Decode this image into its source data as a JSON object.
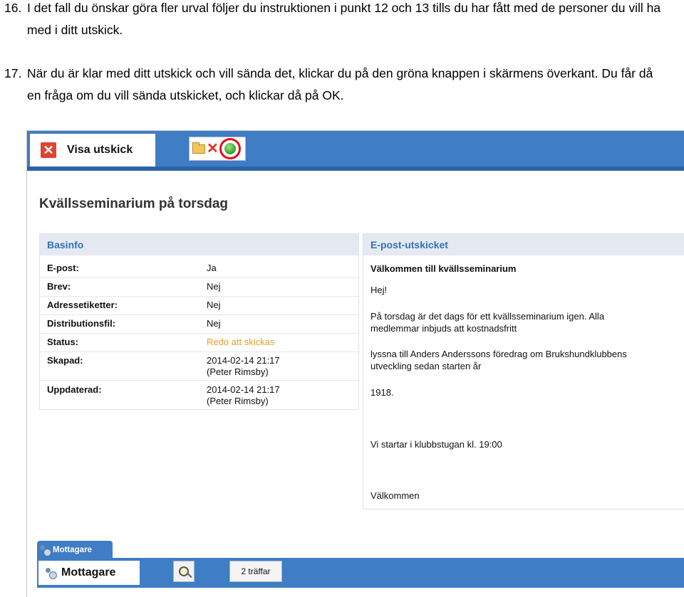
{
  "instructions": [
    {
      "number": "16.",
      "text": "I det fall du önskar göra fler urval följer du instruktionen i punkt 12 och 13 tills du har fått med de personer du vill ha med i ditt utskick."
    },
    {
      "number": "17.",
      "text": "När du är klar med ditt utskick och vill sända det, klickar du på den gröna knappen i skärmens överkant. Du får då en fråga om du vill sända utskicket, och klickar då på OK."
    }
  ],
  "screenshot": {
    "tab_title": "Visa utskick",
    "page_title": "Kvällsseminarium på torsdag",
    "accent_color": "#3f7dc4",
    "basinfo": {
      "heading": "Basinfo",
      "rows": [
        {
          "label": "E-post:",
          "value": "Ja"
        },
        {
          "label": "Brev:",
          "value": "Nej"
        },
        {
          "label": "Adressetiketter:",
          "value": "Nej"
        },
        {
          "label": "Distributionsfil:",
          "value": "Nej"
        },
        {
          "label": "Status:",
          "value": "Redo att skickas"
        },
        {
          "label": "Skapad:",
          "value": "2014-02-14 21:17",
          "value2": "(Peter Rimsby)"
        },
        {
          "label": "Uppdaterad:",
          "value": "2014-02-14 21:17",
          "value2": "(Peter Rimsby)"
        }
      ]
    },
    "epost": {
      "heading": "E-post-utskicket",
      "subject": "Välkommen till kvällsseminarium",
      "greeting": "Hej!",
      "para1_line1": "På torsdag är det dags för ett kvällsseminarium igen. Alla",
      "para1_line2": "medlemmar inbjuds att kostnadsfritt",
      "para2_line1": "lyssna till Anders Anderssons föredrag om Brukshundklubbens",
      "para2_line2": "utveckling sedan starten år",
      "year": "1918.",
      "start_time": "Vi startar i klubbstugan kl. 19:00",
      "closing": "Välkommen"
    },
    "recipients": {
      "small_tab": "Mottagare",
      "tab_title": "Mottagare",
      "hits": "2 träffar"
    },
    "icons": [
      "close-icon",
      "folder-icon",
      "delete-icon",
      "send-icon",
      "people-icon",
      "search-icon"
    ]
  }
}
